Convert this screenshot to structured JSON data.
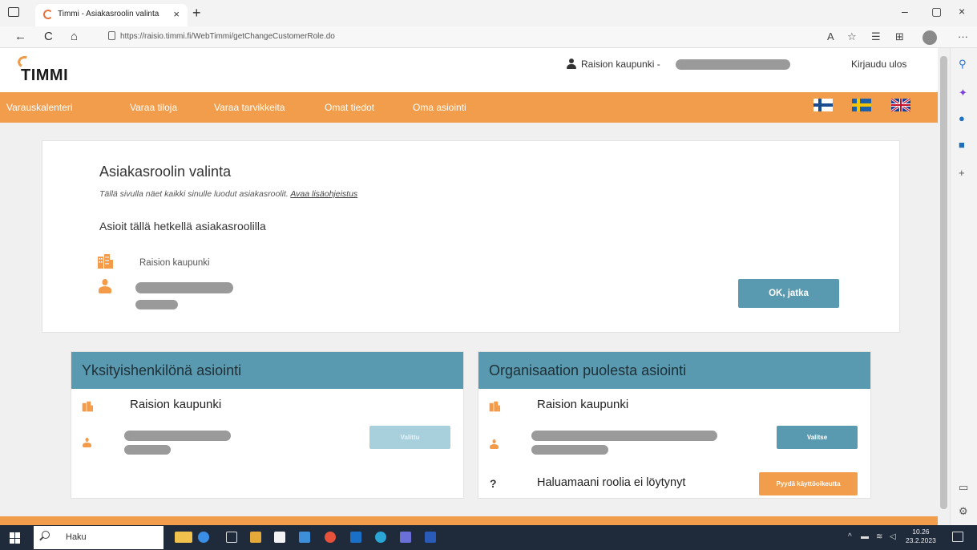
{
  "browser": {
    "tab_title": "Timmi - Asiakasroolin valinta",
    "tab_close": "×",
    "new_tab": "+",
    "url": "https://raisio.timmi.fi/WebTimmi/getChangeCustomerRole.do",
    "window_min": "–",
    "window_restore": "▢",
    "window_close": "×",
    "back": "←",
    "reload": "C",
    "home": "⌂",
    "more": "···"
  },
  "header": {
    "logo": "TIMMI",
    "user_name": "Raision kaupunki -",
    "logout": "Kirjaudu ulos"
  },
  "menu": {
    "items": [
      "Varauskalenteri",
      "Varaa tiloja",
      "Varaa tarvikkeita",
      "Omat tiedot",
      "Oma asiointi"
    ]
  },
  "main": {
    "title": "Asiakasroolin valinta",
    "help_text": "Tällä sivulla näet kaikki sinulle luodut asiakasroolit.",
    "help_link": "Avaa lisäohjeistus",
    "current_heading": "Asioit tällä hetkellä asiakasroolilla",
    "current_org": "Raision kaupunki",
    "ok_button": "OK, jatka"
  },
  "private_panel": {
    "title": "Yksityishenkilönä asiointi",
    "org": "Raision kaupunki",
    "button": "Valittu"
  },
  "org_panel": {
    "title": "Organisaation puolesta asiointi",
    "org": "Raision kaupunki",
    "select_button": "Valitse",
    "question_mark": "?",
    "missing_role": "Haluamaani roolia ei löytynyt",
    "request_button": "Pyydä käyttöoikeutta"
  },
  "taskbar": {
    "search": "Haku",
    "time": "10.26",
    "date": "23.2.2023"
  },
  "colors": {
    "accent_orange": "#f19d4b",
    "teal": "#5a9ab0"
  }
}
